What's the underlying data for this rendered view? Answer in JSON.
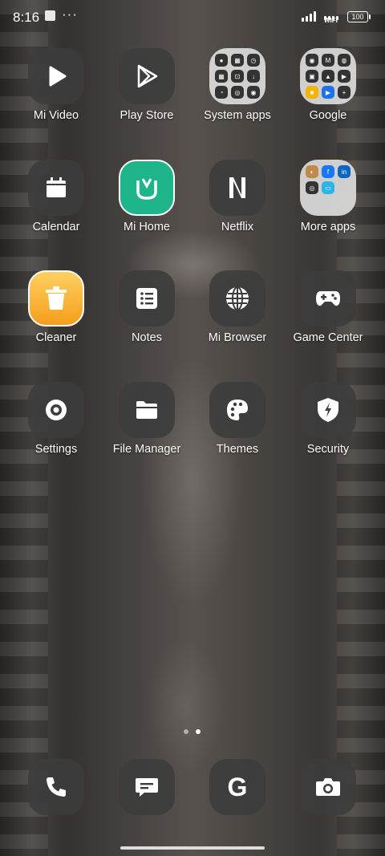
{
  "status": {
    "time": "8:16",
    "wifi_label": "WIFI",
    "battery": "100"
  },
  "apps": [
    {
      "label": "Mi Video",
      "icon": "play-icon"
    },
    {
      "label": "Play Store",
      "icon": "play-store-icon"
    },
    {
      "label": "System apps",
      "icon": "system-apps-folder-icon"
    },
    {
      "label": "Google",
      "icon": "google-folder-icon"
    },
    {
      "label": "Calendar",
      "icon": "calendar-icon"
    },
    {
      "label": "Mi Home",
      "icon": "mi-home-icon"
    },
    {
      "label": "Netflix",
      "icon": "netflix-icon"
    },
    {
      "label": "More apps",
      "icon": "more-apps-folder-icon"
    },
    {
      "label": "Cleaner",
      "icon": "cleaner-icon"
    },
    {
      "label": "Notes",
      "icon": "notes-icon"
    },
    {
      "label": "Mi Browser",
      "icon": "globe-icon"
    },
    {
      "label": "Game Center",
      "icon": "gamepad-icon"
    },
    {
      "label": "Settings",
      "icon": "gear-icon"
    },
    {
      "label": "File Manager",
      "icon": "folder-icon"
    },
    {
      "label": "Themes",
      "icon": "palette-icon"
    },
    {
      "label": "Security",
      "icon": "shield-icon"
    }
  ],
  "dock": [
    {
      "icon": "phone-icon"
    },
    {
      "icon": "messages-icon"
    },
    {
      "icon": "google-g-icon",
      "glyph": "G"
    },
    {
      "icon": "camera-icon"
    }
  ],
  "pages": {
    "count": 2,
    "current": 2
  },
  "colors": {
    "mi_home": "#1fb58a",
    "cleaner": "#f6a623",
    "icon_bg": "#3c3c3c"
  }
}
